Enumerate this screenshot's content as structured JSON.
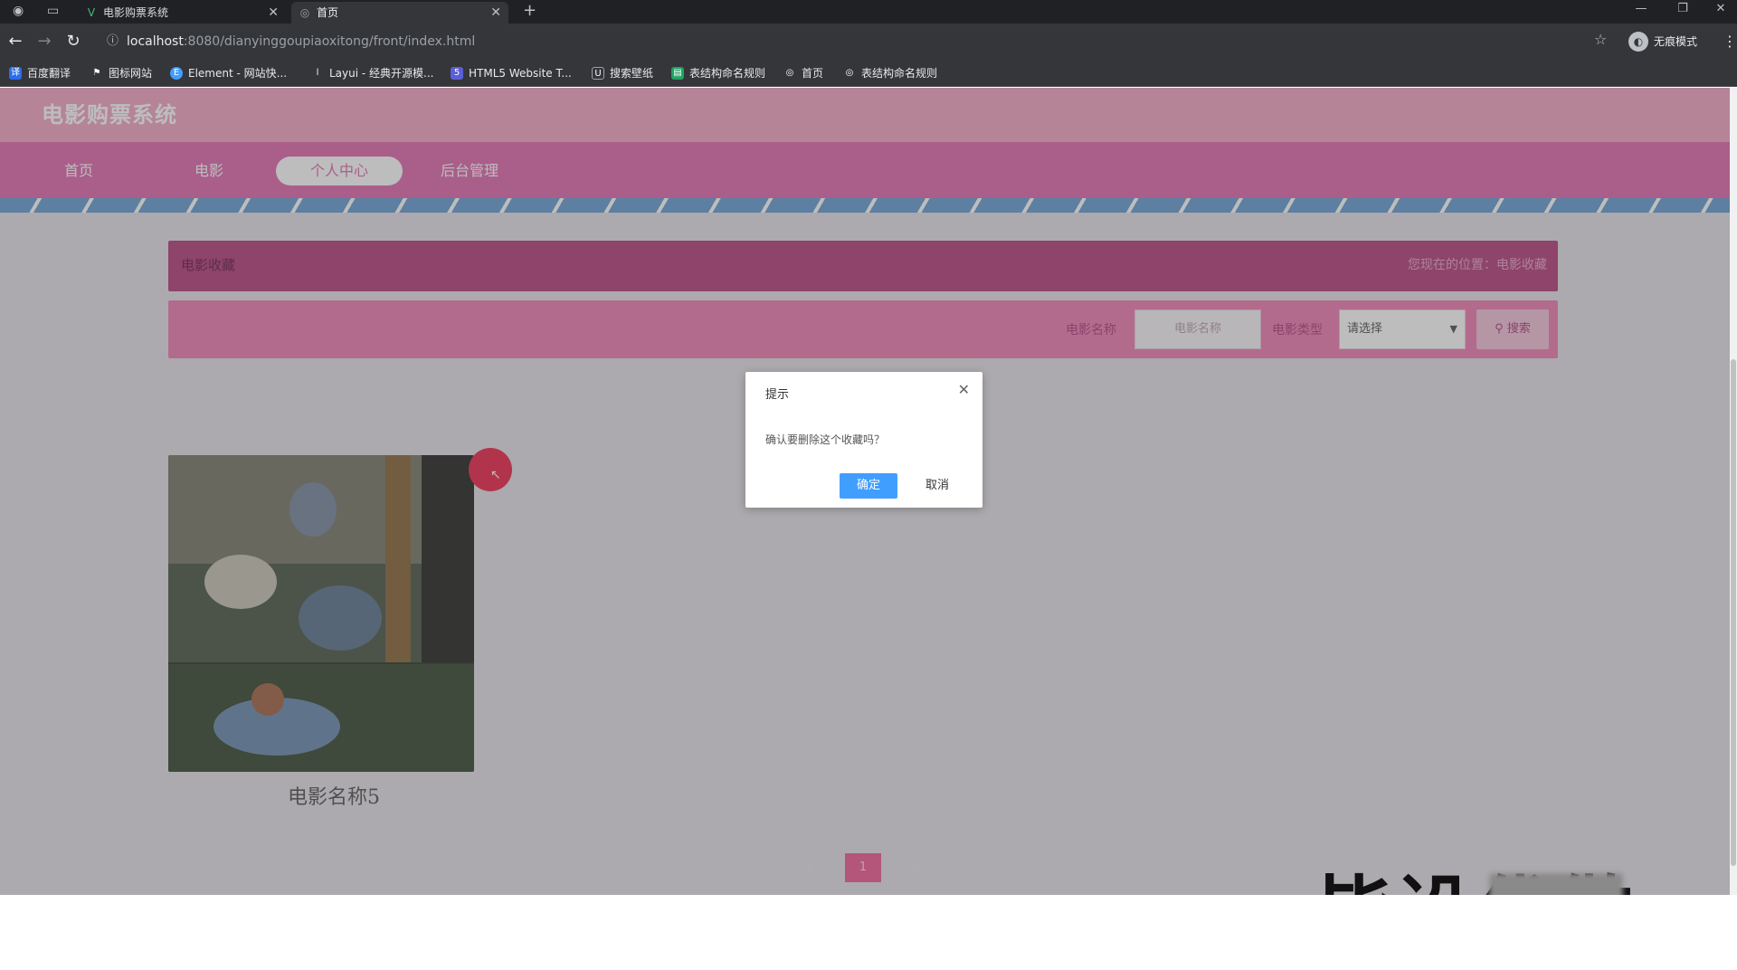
{
  "browser": {
    "tabs": [
      {
        "title": "电影购票系统",
        "icon": "vue-logo-icon"
      },
      {
        "title": "首页",
        "icon": "globe-icon"
      }
    ],
    "url_host": "localhost",
    "url_path": ":8080/dianyinggoupiaoxitong/front/index.html",
    "profile_label": "无痕模式",
    "bookmarks": [
      {
        "label": "百度翻译",
        "icon": "translate-icon"
      },
      {
        "label": "图标网站",
        "icon": "flag-icon"
      },
      {
        "label": "Element - 网站快...",
        "icon": "element-icon"
      },
      {
        "label": "Layui - 经典开源模...",
        "icon": "layui-icon"
      },
      {
        "label": "HTML5 Website T...",
        "icon": "html5-icon"
      },
      {
        "label": "搜索壁纸",
        "icon": "wallpaper-icon"
      },
      {
        "label": "表结构命名规则",
        "icon": "sheet-icon"
      },
      {
        "label": "首页",
        "icon": "globe-icon"
      },
      {
        "label": "表结构命名规则",
        "icon": "globe-icon"
      }
    ]
  },
  "site": {
    "title": "电影购票系统",
    "nav": [
      {
        "label": "首页",
        "active": false
      },
      {
        "label": "电影",
        "active": false
      },
      {
        "label": "个人中心",
        "active": true
      },
      {
        "label": "后台管理",
        "active": false
      }
    ]
  },
  "breadcrumb": {
    "title": "电影收藏",
    "location": "您现在的位置：电影收藏"
  },
  "search": {
    "name_label": "电影名称",
    "name_placeholder": "电影名称",
    "type_label": "电影类型",
    "type_selected": "请选择",
    "button_label": "搜索"
  },
  "movies": [
    {
      "name": "电影名称5"
    }
  ],
  "pagination": {
    "prev": "‹",
    "current": "1",
    "next": "›"
  },
  "dialog": {
    "title": "提示",
    "message": "确认要删除这个收藏吗？",
    "ok_label": "确定",
    "cancel_label": "取消"
  },
  "watermark": {
    "text": "毕设代做"
  },
  "colors": {
    "header": "#f3a6c4",
    "navbar": "#e06cb0",
    "accent": "#409eff",
    "delete": "#ee2a4f"
  }
}
